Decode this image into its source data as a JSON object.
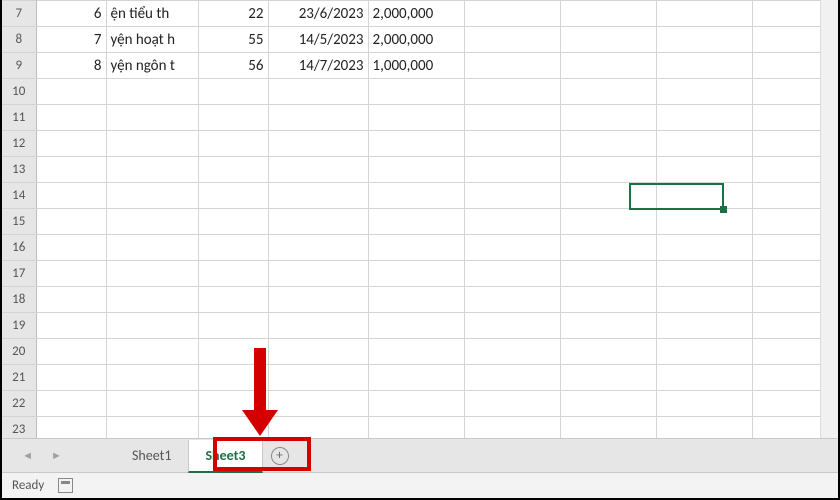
{
  "rows": [
    {
      "hdr": "7",
      "a": "6",
      "b": "ện tiểu th",
      "c": "22",
      "d": "23/6/2023",
      "e": "2,000,000"
    },
    {
      "hdr": "8",
      "a": "7",
      "b": "yện hoạt h",
      "c": "55",
      "d": "14/5/2023",
      "e": "2,000,000"
    },
    {
      "hdr": "9",
      "a": "8",
      "b": "yện ngôn t",
      "c": "56",
      "d": "14/7/2023",
      "e": "1,000,000"
    },
    {
      "hdr": "10"
    },
    {
      "hdr": "11"
    },
    {
      "hdr": "12"
    },
    {
      "hdr": "13"
    },
    {
      "hdr": "14"
    },
    {
      "hdr": "15"
    },
    {
      "hdr": "16"
    },
    {
      "hdr": "17"
    },
    {
      "hdr": "18"
    },
    {
      "hdr": "19"
    },
    {
      "hdr": "20"
    },
    {
      "hdr": "21"
    },
    {
      "hdr": "22"
    },
    {
      "hdr": "23"
    }
  ],
  "tabs": {
    "sheet1": "Sheet1",
    "sheet3": "Sheet3"
  },
  "status": {
    "ready": "Ready"
  },
  "nav": {
    "left": "◄",
    "right": "►"
  },
  "add_label": "+"
}
